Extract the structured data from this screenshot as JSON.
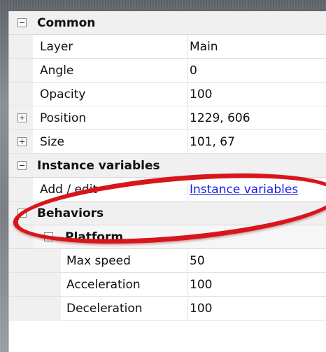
{
  "properties": {
    "common": {
      "label": "Common",
      "rows": [
        {
          "label": "Layer",
          "value": "Main"
        },
        {
          "label": "Angle",
          "value": "0"
        },
        {
          "label": "Opacity",
          "value": "100"
        },
        {
          "label": "Position",
          "value": "1229, 606"
        },
        {
          "label": "Size",
          "value": "101, 67"
        }
      ]
    },
    "instance_variables": {
      "label": "Instance variables",
      "row": {
        "label": "Add / edit",
        "value": "Instance variables"
      }
    },
    "behaviors": {
      "label": "Behaviors",
      "platform": {
        "label": "Platform",
        "rows": [
          {
            "label": "Max speed",
            "value": "50"
          },
          {
            "label": "Acceleration",
            "value": "100"
          },
          {
            "label": "Deceleration",
            "value": "100"
          }
        ]
      }
    }
  },
  "colors": {
    "link": "#1a1ae6",
    "highlight_ellipse": "#d8151b"
  }
}
